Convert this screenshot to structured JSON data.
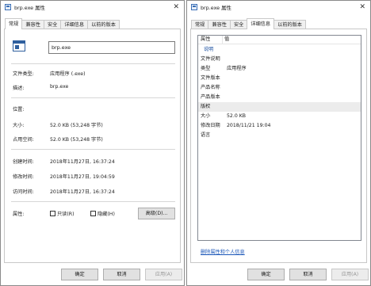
{
  "left_window": {
    "title": "brp.exe 属性",
    "close_glyph": "✕",
    "tabs": [
      "常规",
      "兼容性",
      "安全",
      "详细信息",
      "以前的版本"
    ],
    "active_tab": "常规",
    "filename_value": "brp.exe",
    "rows": {
      "file_type_label": "文件类型:",
      "file_type_value": "应用程序 (.exe)",
      "description_label": "描述:",
      "description_value": "brp.exe",
      "location_label": "位置:",
      "location_value": "",
      "size_label": "大小:",
      "size_value": "52.0 KB (53,248 字节)",
      "disk_size_label": "占用空间:",
      "disk_size_value": "52.0 KB (53,248 字节)",
      "created_label": "创建时间:",
      "created_value": "2018年11月27日, 16:37:24",
      "modified_label": "修改时间:",
      "modified_value": "2018年11月27日, 19:04:59",
      "accessed_label": "访问时间:",
      "accessed_value": "2018年11月27日, 16:37:24",
      "attributes_label": "属性:",
      "readonly_label": "只读(R)",
      "hidden_label": "隐藏(H)",
      "advanced_button": "高级(D)..."
    },
    "buttons": {
      "ok": "确定",
      "cancel": "取消",
      "apply": "应用(A)"
    }
  },
  "right_window": {
    "title": "brp.exe 属性",
    "close_glyph": "✕",
    "tabs": [
      "常规",
      "兼容性",
      "安全",
      "详细信息",
      "以前的版本"
    ],
    "active_tab": "详细信息",
    "list_header": {
      "property": "属性",
      "value": "值"
    },
    "rows": [
      {
        "key": "说明",
        "value": "",
        "group": true,
        "shaded": false
      },
      {
        "key": "文件说明",
        "value": "",
        "group": false,
        "shaded": false
      },
      {
        "key": "类型",
        "value": "应用程序",
        "group": false,
        "shaded": false
      },
      {
        "key": "文件版本",
        "value": "",
        "group": false,
        "shaded": false
      },
      {
        "key": "产品名称",
        "value": "",
        "group": false,
        "shaded": false
      },
      {
        "key": "产品版本",
        "value": "",
        "group": false,
        "shaded": false
      },
      {
        "key": "版权",
        "value": "",
        "group": false,
        "shaded": true
      },
      {
        "key": "大小",
        "value": "52.0 KB",
        "group": false,
        "shaded": false
      },
      {
        "key": "修改日期",
        "value": "2018/11/21 19:04",
        "group": false,
        "shaded": false
      },
      {
        "key": "语言",
        "value": "",
        "group": false,
        "shaded": false
      }
    ],
    "remove_link": "删除属性和个人信息",
    "buttons": {
      "ok": "确定",
      "cancel": "取消",
      "apply": "应用(A)"
    }
  }
}
